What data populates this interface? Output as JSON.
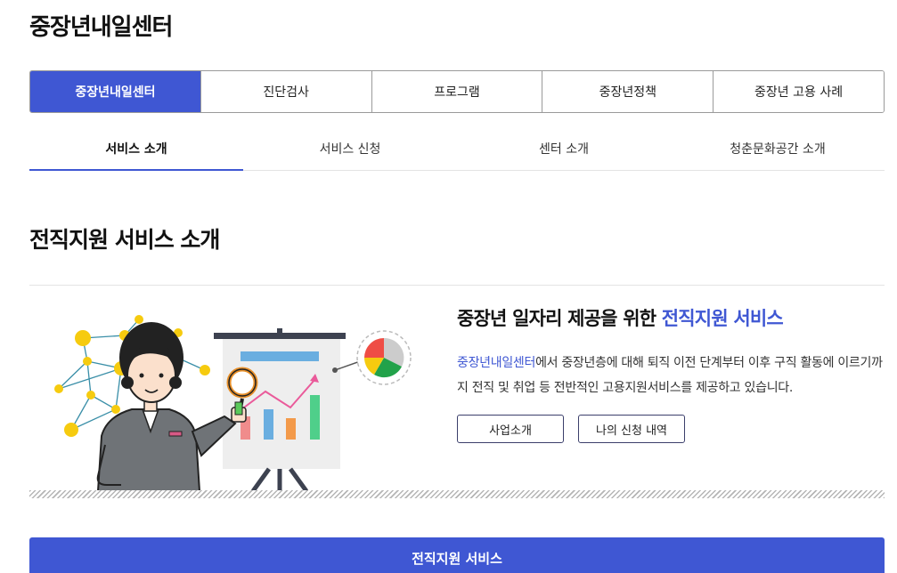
{
  "page": {
    "title": "중장년내일센터"
  },
  "main_tabs": [
    {
      "label": "중장년내일센터",
      "active": true
    },
    {
      "label": "진단검사",
      "active": false
    },
    {
      "label": "프로그램",
      "active": false
    },
    {
      "label": "중장년정책",
      "active": false
    },
    {
      "label": "중장년 고용 사례",
      "active": false
    }
  ],
  "sub_tabs": [
    {
      "label": "서비스 소개",
      "active": true
    },
    {
      "label": "서비스 신청",
      "active": false
    },
    {
      "label": "센터 소개",
      "active": false
    },
    {
      "label": "청춘문화공간 소개",
      "active": false
    }
  ],
  "section": {
    "title": "전직지원 서비스 소개"
  },
  "info": {
    "heading_prefix": "중장년 일자리 제공을 위한 ",
    "heading_accent": "전직지원 서비스",
    "desc_accent": "중장년내일센터",
    "desc_rest": "에서 중장년층에 대해 퇴직 이전 단계부터 이후 구직 활동에 이르기까지 전직 및 취업 등 전반적인 고용지원서비스를 제공하고 있습니다."
  },
  "buttons": {
    "business_intro": "사업소개",
    "my_applications": "나의 신청 내역"
  },
  "bottom_bar": {
    "label": "전직지원 서비스"
  },
  "colors": {
    "accent": "#3f57d3",
    "border": "#9a9a9a"
  }
}
